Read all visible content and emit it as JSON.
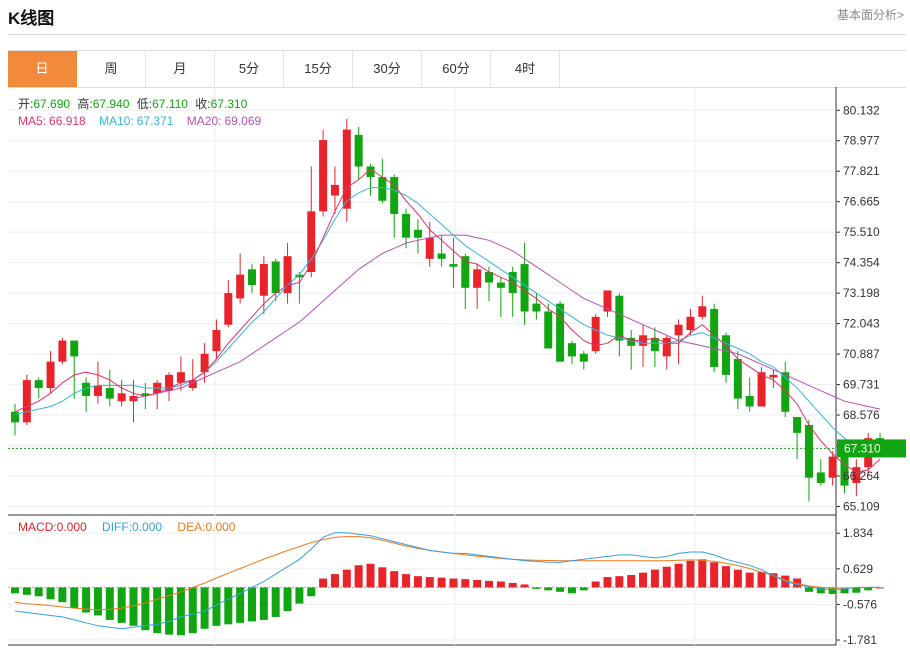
{
  "header": {
    "title": "K线图",
    "link": "基本面分析>"
  },
  "tabs": [
    "日",
    "周",
    "月",
    "5分",
    "15分",
    "30分",
    "60分",
    "4时"
  ],
  "active_tab": 0,
  "ohlc": {
    "open_label": "开:",
    "open": "67.690",
    "high_label": "高:",
    "high": "67.940",
    "low_label": "低:",
    "low": "67.110",
    "close_label": "收:",
    "close": "67.310"
  },
  "ma_legend": {
    "ma5_label": "MA5:",
    "ma5": "66.918",
    "ma10_label": "MA10:",
    "ma10": "67.371",
    "ma20_label": "MA20:",
    "ma20": "69.069"
  },
  "macd_legend": {
    "macd_label": "MACD:",
    "macd": "0.000",
    "diff_label": "DIFF:",
    "diff": "0.000",
    "dea_label": "DEA:",
    "dea": "0.000"
  },
  "current_price_tag": "67.310",
  "colors": {
    "up": "#e8232a",
    "down": "#11a511",
    "ma5": "#e0336b",
    "ma10": "#35b7d8",
    "ma20": "#b752b7",
    "dea": "#f07a1a",
    "diff": "#35a0e0",
    "tab_active": "#f28a3c"
  },
  "chart_data": [
    {
      "type": "candlestick",
      "price_axis_ticks": [
        "80.132",
        "78.977",
        "77.821",
        "76.665",
        "75.510",
        "74.354",
        "73.198",
        "72.043",
        "70.887",
        "69.731",
        "68.576",
        "67.420",
        "66.264",
        "65.109"
      ],
      "ylim": [
        64.9,
        80.9
      ],
      "candles": [
        [
          68.7,
          68.3,
          69.0,
          67.8
        ],
        [
          68.3,
          69.9,
          70.1,
          68.2
        ],
        [
          69.9,
          69.6,
          70.0,
          69.2
        ],
        [
          69.6,
          70.6,
          71.0,
          69.4
        ],
        [
          70.6,
          71.4,
          71.5,
          70.5
        ],
        [
          71.4,
          70.8,
          71.4,
          69.2
        ],
        [
          69.8,
          69.3,
          70.0,
          68.7
        ],
        [
          69.3,
          69.7,
          70.6,
          69.0
        ],
        [
          69.6,
          69.2,
          70.3,
          68.9
        ],
        [
          69.1,
          69.4,
          69.9,
          68.9
        ],
        [
          69.1,
          69.3,
          69.9,
          68.3
        ],
        [
          69.4,
          69.3,
          69.8,
          68.8
        ],
        [
          69.4,
          69.8,
          69.9,
          68.8
        ],
        [
          69.5,
          70.1,
          70.2,
          69.1
        ],
        [
          69.8,
          70.2,
          70.8,
          69.5
        ],
        [
          69.6,
          69.9,
          70.7,
          69.5
        ],
        [
          70.2,
          70.9,
          71.3,
          69.8
        ],
        [
          71.0,
          71.8,
          72.2,
          70.7
        ],
        [
          72.0,
          73.2,
          73.7,
          71.9
        ],
        [
          73.0,
          73.9,
          74.7,
          72.8
        ],
        [
          74.1,
          73.5,
          74.3,
          73.2
        ],
        [
          73.1,
          74.3,
          74.6,
          72.4
        ],
        [
          74.4,
          73.2,
          74.5,
          72.9
        ],
        [
          73.2,
          74.6,
          75.1,
          72.8
        ],
        [
          73.9,
          73.8,
          74.0,
          72.8
        ],
        [
          74.0,
          76.3,
          78.0,
          73.8
        ],
        [
          76.3,
          79.0,
          79.4,
          76.1
        ],
        [
          76.9,
          77.3,
          78.0,
          76.2
        ],
        [
          76.4,
          79.4,
          79.8,
          75.9
        ],
        [
          79.2,
          78.0,
          79.5,
          77.5
        ],
        [
          78.0,
          77.6,
          78.1,
          76.9
        ],
        [
          77.6,
          76.7,
          78.3,
          76.6
        ],
        [
          77.6,
          76.2,
          77.7,
          75.3
        ],
        [
          76.2,
          75.3,
          76.4,
          74.9
        ],
        [
          75.6,
          75.3,
          76.0,
          74.7
        ],
        [
          74.5,
          75.3,
          75.9,
          74.2
        ],
        [
          74.7,
          74.5,
          75.4,
          74.2
        ],
        [
          74.3,
          74.2,
          75.3,
          73.4
        ],
        [
          74.6,
          73.4,
          74.7,
          72.6
        ],
        [
          73.4,
          74.1,
          74.3,
          72.6
        ],
        [
          74.0,
          73.6,
          74.2,
          72.9
        ],
        [
          73.6,
          73.4,
          73.8,
          72.3
        ],
        [
          74.0,
          73.2,
          74.2,
          72.3
        ],
        [
          74.3,
          72.5,
          75.1,
          72.0
        ],
        [
          72.8,
          72.5,
          73.2,
          72.2
        ],
        [
          72.5,
          71.1,
          72.8,
          71.2
        ],
        [
          72.8,
          70.6,
          72.9,
          70.8
        ],
        [
          71.3,
          70.8,
          71.4,
          70.5
        ],
        [
          70.9,
          70.6,
          71.0,
          70.3
        ],
        [
          71.0,
          72.3,
          72.4,
          70.9
        ],
        [
          72.5,
          73.3,
          73.3,
          72.3
        ],
        [
          73.1,
          71.4,
          73.2,
          70.8
        ],
        [
          71.5,
          71.2,
          71.8,
          70.3
        ],
        [
          71.2,
          71.6,
          72.0,
          70.4
        ],
        [
          71.5,
          71.0,
          71.9,
          70.4
        ],
        [
          70.8,
          71.5,
          71.6,
          70.3
        ],
        [
          71.6,
          72.0,
          72.2,
          70.5
        ],
        [
          71.8,
          72.3,
          72.6,
          71.6
        ],
        [
          72.3,
          72.7,
          73.1,
          72.2
        ],
        [
          72.6,
          70.4,
          72.8,
          70.2
        ],
        [
          71.6,
          70.1,
          71.7,
          69.8
        ],
        [
          70.7,
          69.2,
          71.0,
          68.8
        ],
        [
          69.3,
          68.9,
          70.0,
          68.7
        ],
        [
          68.9,
          70.2,
          70.4,
          68.9
        ],
        [
          70.0,
          70.1,
          70.3,
          69.6
        ],
        [
          70.2,
          68.7,
          70.6,
          68.5
        ],
        [
          68.5,
          67.9,
          68.5,
          66.9
        ],
        [
          68.2,
          66.2,
          68.4,
          65.3
        ],
        [
          66.4,
          66.0,
          66.9,
          65.9
        ],
        [
          66.2,
          67.0,
          67.2,
          65.9
        ],
        [
          67.0,
          65.9,
          67.3,
          65.6
        ],
        [
          66.0,
          66.6,
          66.9,
          65.5
        ],
        [
          66.6,
          67.7,
          67.9,
          66.3
        ],
        [
          67.7,
          67.3,
          67.9,
          67.1
        ]
      ],
      "ma5": [
        68.7,
        68.9,
        69.1,
        69.4,
        69.8,
        70.1,
        70.2,
        70.1,
        69.9,
        69.6,
        69.4,
        69.3,
        69.4,
        69.6,
        69.8,
        69.9,
        70.2,
        70.7,
        71.3,
        71.8,
        72.3,
        72.8,
        73.2,
        73.5,
        73.6,
        74.3,
        75.3,
        76.3,
        77.2,
        77.5,
        77.9,
        77.6,
        77.3,
        76.7,
        76.2,
        75.6,
        75.2,
        74.8,
        74.4,
        74.3,
        74.0,
        73.8,
        73.6,
        73.3,
        73.0,
        72.6,
        72.3,
        71.8,
        71.4,
        71.2,
        71.3,
        71.6,
        71.4,
        71.4,
        71.5,
        71.3,
        71.3,
        71.7,
        72.0,
        71.6,
        71.2,
        70.7,
        70.4,
        70.1,
        69.9,
        69.5,
        69.0,
        68.2,
        67.6,
        67.1,
        66.7,
        66.4,
        66.5,
        66.9
      ],
      "ma10": [
        68.6,
        68.7,
        68.8,
        68.9,
        69.1,
        69.4,
        69.6,
        69.7,
        69.7,
        69.7,
        69.7,
        69.6,
        69.6,
        69.6,
        69.7,
        69.9,
        70.2,
        70.6,
        71.1,
        71.6,
        72.1,
        72.5,
        73.0,
        73.5,
        73.9,
        74.5,
        75.2,
        76.0,
        76.7,
        77.0,
        77.2,
        77.2,
        77.1,
        76.9,
        76.6,
        76.2,
        75.8,
        75.4,
        75.0,
        74.7,
        74.4,
        74.1,
        73.8,
        73.5,
        73.2,
        72.9,
        72.6,
        72.3,
        72.0,
        71.8,
        71.6,
        71.5,
        71.4,
        71.3,
        71.3,
        71.3,
        71.4,
        71.6,
        71.7,
        71.5,
        71.3,
        71.1,
        70.9,
        70.6,
        70.4,
        70.0,
        69.6,
        69.1,
        68.6,
        68.1,
        67.7,
        67.4,
        67.3,
        67.3
      ],
      "ma20": [
        null,
        null,
        null,
        null,
        null,
        null,
        null,
        null,
        null,
        null,
        69.2,
        69.3,
        69.4,
        69.5,
        69.6,
        69.8,
        70.0,
        70.2,
        70.4,
        70.6,
        70.9,
        71.2,
        71.5,
        71.8,
        72.1,
        72.5,
        72.9,
        73.3,
        73.7,
        74.1,
        74.4,
        74.7,
        74.9,
        75.1,
        75.2,
        75.3,
        75.4,
        75.4,
        75.4,
        75.3,
        75.2,
        75.0,
        74.8,
        74.5,
        74.2,
        73.9,
        73.6,
        73.3,
        73.0,
        72.8,
        72.6,
        72.4,
        72.2,
        72.0,
        71.8,
        71.6,
        71.4,
        71.3,
        71.2,
        71.1,
        71.0,
        70.9,
        70.7,
        70.5,
        70.3,
        70.1,
        69.9,
        69.7,
        69.5,
        69.3,
        69.1,
        69.0,
        68.9,
        68.8
      ]
    },
    {
      "type": "macd",
      "axis_ticks": [
        "1.834",
        "0.629",
        "-0.576",
        "-1.781"
      ],
      "ylim": [
        -1.95,
        2.35
      ],
      "hist": [
        -0.2,
        -0.25,
        -0.3,
        -0.4,
        -0.5,
        -0.7,
        -0.85,
        -0.95,
        -1.1,
        -1.2,
        -1.3,
        -1.45,
        -1.55,
        -1.6,
        -1.62,
        -1.55,
        -1.4,
        -1.3,
        -1.25,
        -1.2,
        -1.15,
        -1.1,
        -1.0,
        -0.8,
        -0.55,
        -0.3,
        0.3,
        0.45,
        0.6,
        0.75,
        0.8,
        0.68,
        0.55,
        0.45,
        0.38,
        0.35,
        0.33,
        0.3,
        0.28,
        0.25,
        0.22,
        0.2,
        0.15,
        0.1,
        -0.05,
        -0.1,
        -0.15,
        -0.2,
        -0.1,
        0.2,
        0.35,
        0.38,
        0.42,
        0.5,
        0.6,
        0.7,
        0.8,
        0.9,
        0.95,
        0.85,
        0.72,
        0.6,
        0.5,
        0.52,
        0.48,
        0.4,
        0.3,
        -0.15,
        -0.2,
        -0.22,
        -0.2,
        -0.18,
        -0.1,
        0.0
      ],
      "diff": [
        -0.8,
        -0.85,
        -0.9,
        -0.95,
        -1.0,
        -1.1,
        -1.2,
        -1.3,
        -1.35,
        -1.4,
        -1.35,
        -1.3,
        -1.25,
        -1.15,
        -1.0,
        -0.9,
        -0.8,
        -0.6,
        -0.4,
        -0.2,
        0.0,
        0.2,
        0.45,
        0.7,
        0.95,
        1.3,
        1.7,
        1.85,
        1.85,
        1.8,
        1.75,
        1.65,
        1.55,
        1.45,
        1.35,
        1.25,
        1.2,
        1.15,
        1.15,
        1.1,
        1.05,
        1.0,
        0.95,
        0.9,
        0.88,
        0.85,
        0.85,
        0.9,
        0.95,
        1.0,
        1.05,
        1.1,
        1.1,
        1.05,
        1.0,
        1.05,
        1.15,
        1.2,
        1.2,
        1.1,
        0.95,
        0.85,
        0.75,
        0.6,
        0.4,
        0.2,
        0.1,
        0.02,
        -0.05,
        -0.08,
        -0.05,
        0.0,
        0.0,
        0.0
      ],
      "dea": [
        -0.5,
        -0.55,
        -0.58,
        -0.62,
        -0.66,
        -0.7,
        -0.73,
        -0.76,
        -0.74,
        -0.7,
        -0.62,
        -0.52,
        -0.4,
        -0.28,
        -0.15,
        0.0,
        0.15,
        0.32,
        0.48,
        0.64,
        0.8,
        0.96,
        1.1,
        1.25,
        1.38,
        1.52,
        1.62,
        1.7,
        1.72,
        1.72,
        1.68,
        1.6,
        1.5,
        1.4,
        1.32,
        1.25,
        1.2,
        1.15,
        1.1,
        1.06,
        1.02,
        0.98,
        0.95,
        0.93,
        0.92,
        0.91,
        0.9,
        0.9,
        0.9,
        0.9,
        0.9,
        0.9,
        0.9,
        0.9,
        0.9,
        0.9,
        0.92,
        0.93,
        0.92,
        0.88,
        0.82,
        0.74,
        0.64,
        0.52,
        0.4,
        0.25,
        0.13,
        0.05,
        0.0,
        -0.02,
        -0.02,
        -0.01,
        0.0,
        0.0
      ]
    }
  ]
}
